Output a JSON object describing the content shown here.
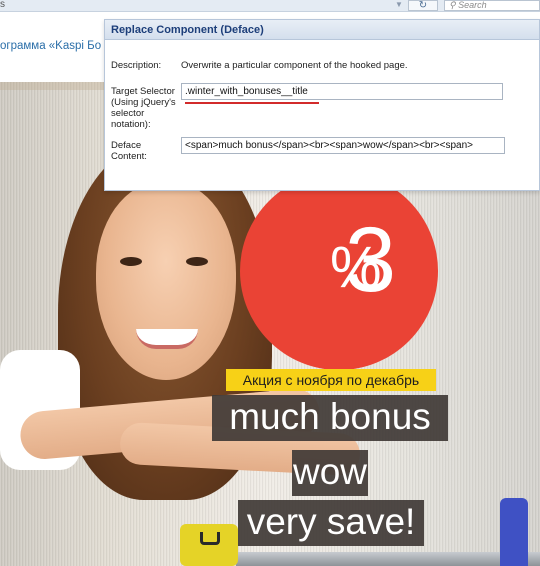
{
  "browser": {
    "reload_icon": "reload-icon",
    "search_placeholder": "Search",
    "url_fragment": "s"
  },
  "page": {
    "header_link": "ограмма «Kaspi Бо"
  },
  "hero": {
    "discount": {
      "value": "3",
      "unit": "%"
    },
    "promo_tag": "Акция с ноября по декабрь",
    "promo_lines": [
      "much bonus",
      "wow",
      "very save!"
    ],
    "colors": {
      "circle": "#ea4335",
      "tag": "#f7d117",
      "line_bg": "#403a36"
    }
  },
  "dialog": {
    "title": "Replace Component (Deface)",
    "description_label": "Description:",
    "description_value": "Overwrite a particular component of the hooked page.",
    "target_label": "Target Selector (Using jQuery's selector notation):",
    "target_value": ".winter_with_bonuses__title",
    "deface_label": "Deface Content:",
    "deface_value": "<span>much bonus</span><br><span>wow</span><br><span>"
  }
}
